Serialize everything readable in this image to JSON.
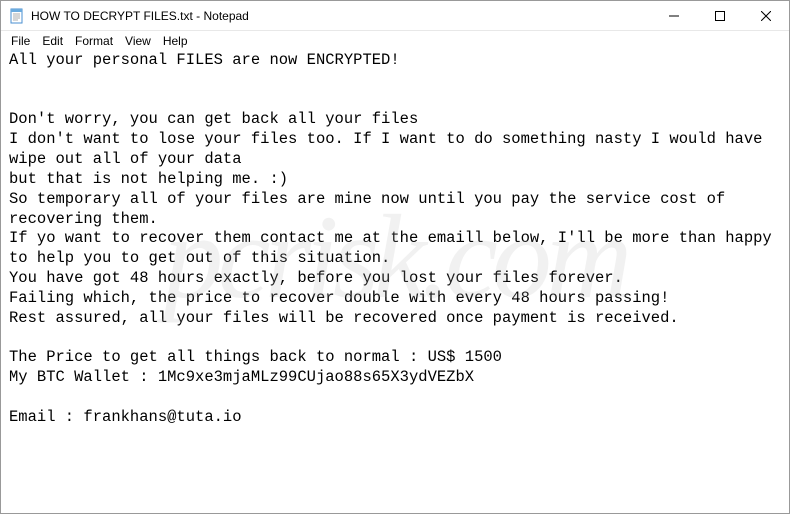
{
  "window": {
    "title": "HOW TO DECRYPT FILES.txt - Notepad"
  },
  "menu": {
    "file": "File",
    "edit": "Edit",
    "format": "Format",
    "view": "View",
    "help": "Help"
  },
  "content": {
    "text": "All your personal FILES are now ENCRYPTED!\n\n\nDon't worry, you can get back all your files\nI don't want to lose your files too. If I want to do something nasty I would have wipe out all of your data\nbut that is not helping me. :)\nSo temporary all of your files are mine now until you pay the service cost of recovering them.\nIf yo want to recover them contact me at the emaill below, I'll be more than happy to help you to get out of this situation.\nYou have got 48 hours exactly, before you lost your files forever.\nFailing which, the price to recover double with every 48 hours passing!\nRest assured, all your files will be recovered once payment is received.\n\nThe Price to get all things back to normal : US$ 1500\nMy BTC Wallet : 1Mc9xe3mjaMLz99CUjao88s65X3ydVEZbX\n\nEmail : frankhans@tuta.io"
  },
  "watermark": "pcrisk.com"
}
